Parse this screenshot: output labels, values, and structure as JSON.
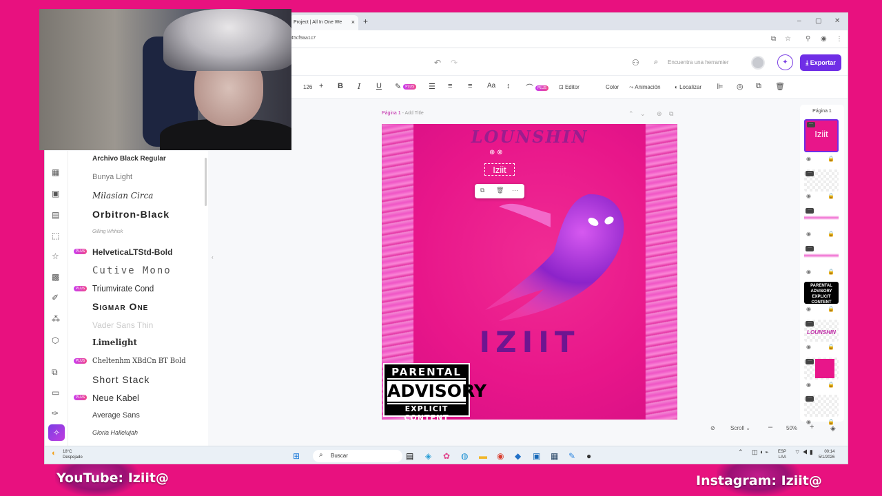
{
  "stream": {
    "youtube": "YouTube: Iziit@",
    "instagram": "Instagram: Iziit@"
  },
  "browser": {
    "tab_title": "Project | All In One We",
    "url_fragment": "45cf9aa1c7",
    "new_tab": "+",
    "close_tab": "×",
    "window_controls": [
      "–",
      "▢",
      "✕"
    ]
  },
  "header": {
    "search_placeholder": "Encuentra una herramier",
    "export_label": "Exportar",
    "accent_color": "#6f2ee6"
  },
  "toolbar": {
    "font_size": "126",
    "editor_label": "Editor",
    "color_label": "Color",
    "animation_label": "Animación",
    "locate_label": "Localizar",
    "plus_badge": "PLUS"
  },
  "font_panel": {
    "fonts": [
      {
        "name": "Archivo Black Regular",
        "plus": false
      },
      {
        "name": "Bunya Light",
        "plus": false
      },
      {
        "name": "Milasian Circa",
        "plus": false
      },
      {
        "name": "Orbitron-Black",
        "plus": false
      },
      {
        "name": "Gilling Whhisk",
        "plus": false
      },
      {
        "name": "HelveticaLTStd-Bold",
        "plus": true
      },
      {
        "name": "Cutive Mono",
        "plus": false
      },
      {
        "name": "Triumvirate Cond",
        "plus": true
      },
      {
        "name": "Sigmar One",
        "plus": false
      },
      {
        "name": "Vader Sans Thin",
        "plus": false
      },
      {
        "name": "Limelight",
        "plus": false
      },
      {
        "name": "Cheltenhm XBdCn BT Bold",
        "plus": true
      },
      {
        "name": "Short Stack",
        "plus": false
      },
      {
        "name": "Neue Kabel",
        "plus": true
      },
      {
        "name": "Average Sans",
        "plus": false
      },
      {
        "name": "Gloria Hallelujah",
        "plus": false
      }
    ]
  },
  "canvas": {
    "page_label": "Página 1",
    "page_title_placeholder": "- Add Title",
    "artwork_top_title": "LOUNSHIN",
    "selected_text": "Iziit",
    "artwork_main_title": "IZIIT",
    "parental_advisory": {
      "line1": "PARENTAL",
      "line2": "ADVISORY",
      "line3": "EXPLICIT CONTENT"
    },
    "background_color": "#e8168a"
  },
  "layers_panel": {
    "title": "Página 1",
    "layers": [
      {
        "label": "Iziit",
        "selected": true
      },
      {
        "label": "",
        "selected": false
      },
      {
        "label": "",
        "selected": false
      },
      {
        "label": "",
        "selected": false
      },
      {
        "label": "PARENTAL ADVISORY EXPLICIT CONTENT",
        "selected": false
      },
      {
        "label": "LOUNSHIN",
        "selected": false
      },
      {
        "label": "",
        "selected": false
      },
      {
        "label": "",
        "selected": false
      }
    ]
  },
  "bottom": {
    "scroll_label": "Scroll",
    "zoom": "50%"
  },
  "taskbar": {
    "search_label": "Buscar",
    "weather_temp": "18°C",
    "weather_desc": "Despejado",
    "lang": "ESP",
    "lang_sub": "LAA",
    "time": "00:14",
    "date": "5/1/2026"
  }
}
